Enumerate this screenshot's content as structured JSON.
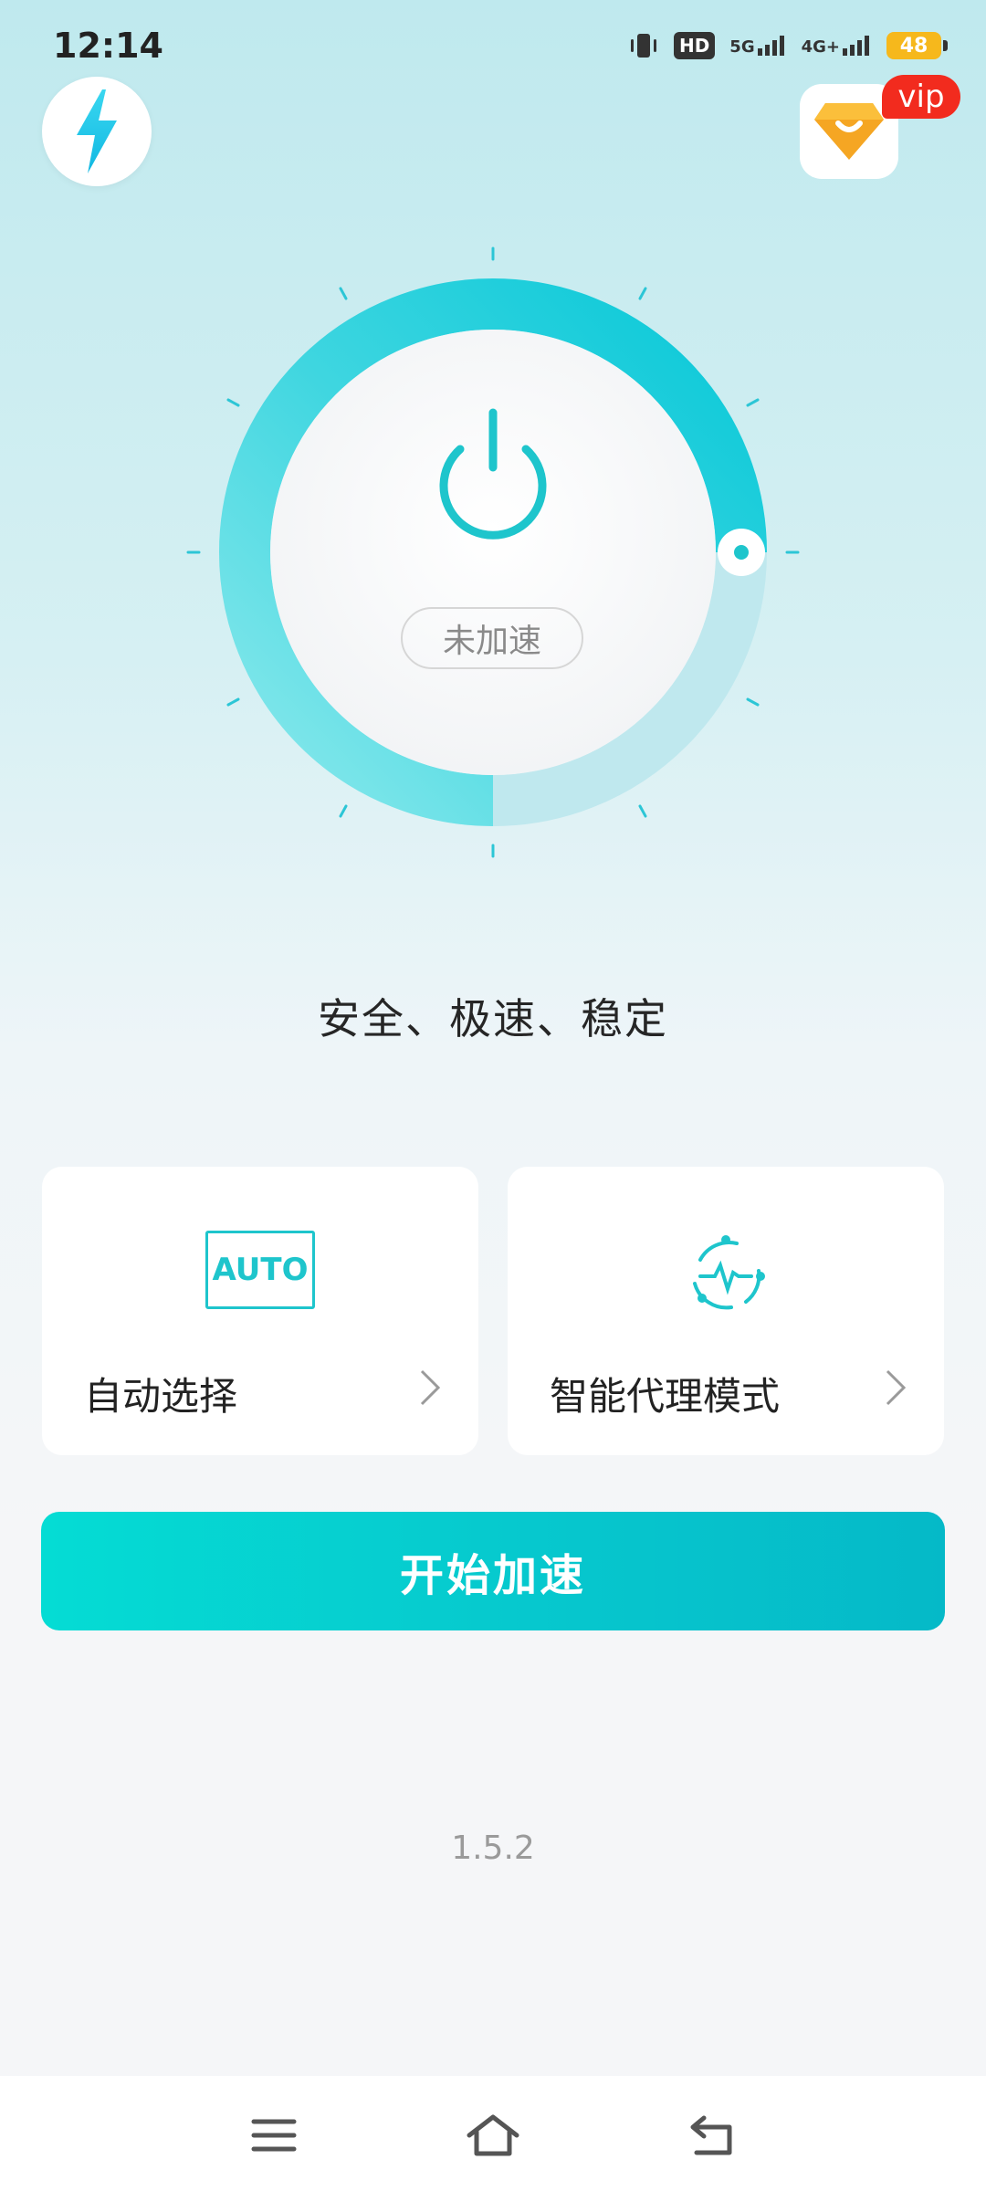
{
  "status_bar": {
    "time": "12:14",
    "hd_label": "HD",
    "net1": "5G",
    "net2": "4G+",
    "battery": "48"
  },
  "header": {
    "vip_label": "vip"
  },
  "dial": {
    "state_label": "未加速",
    "progress_fraction": 0.75
  },
  "slogan": "安全、极速、稳定",
  "cards": {
    "auto": {
      "icon_text": "AUTO",
      "label": "自动选择"
    },
    "proxy": {
      "label": "智能代理模式"
    }
  },
  "start_button": {
    "label": "开始加速"
  },
  "version": "1.5.2",
  "colors": {
    "accent": "#06c6cd",
    "vip": "#f22b1e",
    "gem": "#f5a623"
  }
}
